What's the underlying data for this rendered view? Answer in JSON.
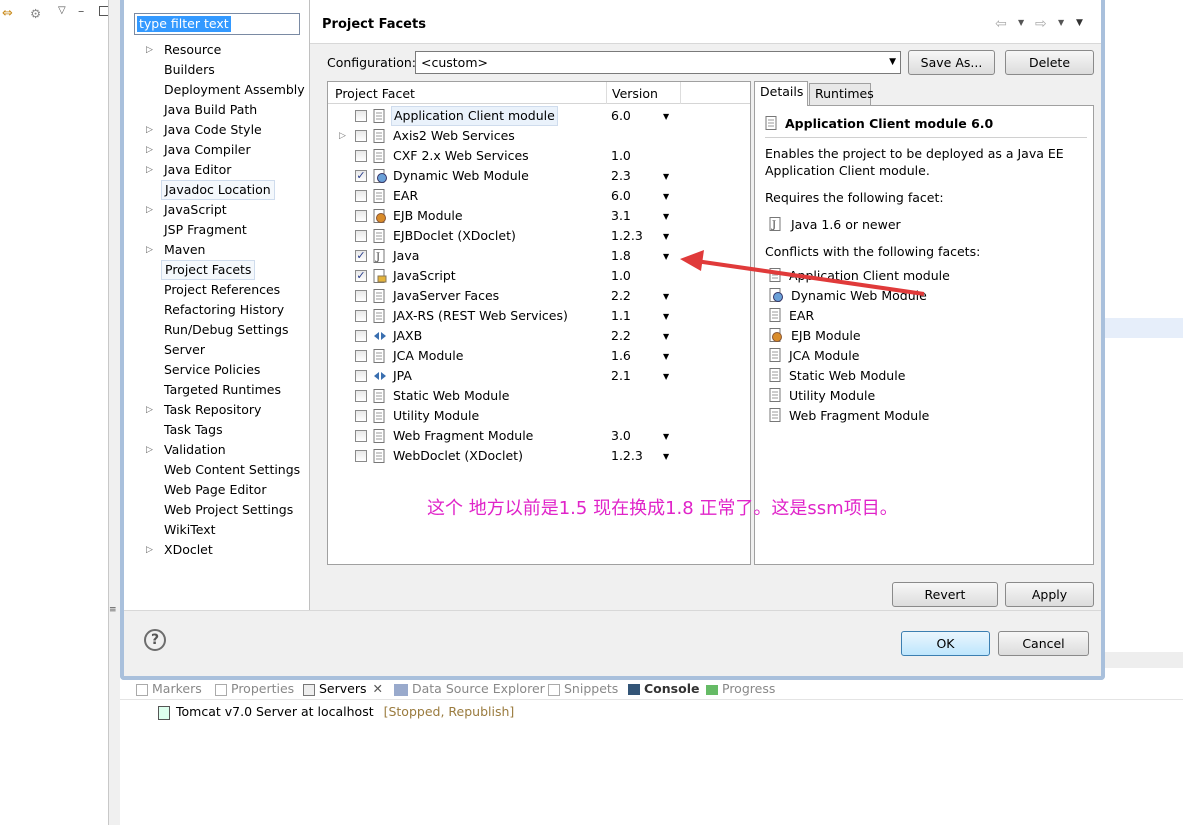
{
  "dialog": {
    "filter_placeholder": "type filter text",
    "nav_items": [
      {
        "label": "Resource",
        "expandable": true
      },
      {
        "label": "Builders",
        "expandable": false
      },
      {
        "label": "Deployment Assembly",
        "expandable": false
      },
      {
        "label": "Java Build Path",
        "expandable": false
      },
      {
        "label": "Java Code Style",
        "expandable": true
      },
      {
        "label": "Java Compiler",
        "expandable": true
      },
      {
        "label": "Java Editor",
        "expandable": true
      },
      {
        "label": "Javadoc Location",
        "expandable": false
      },
      {
        "label": "JavaScript",
        "expandable": true
      },
      {
        "label": "JSP Fragment",
        "expandable": false
      },
      {
        "label": "Maven",
        "expandable": true
      },
      {
        "label": "Project Facets",
        "expandable": false,
        "selected": true
      },
      {
        "label": "Project References",
        "expandable": false
      },
      {
        "label": "Refactoring History",
        "expandable": false
      },
      {
        "label": "Run/Debug Settings",
        "expandable": false
      },
      {
        "label": "Server",
        "expandable": false
      },
      {
        "label": "Service Policies",
        "expandable": false
      },
      {
        "label": "Targeted Runtimes",
        "expandable": false
      },
      {
        "label": "Task Repository",
        "expandable": true
      },
      {
        "label": "Task Tags",
        "expandable": false
      },
      {
        "label": "Validation",
        "expandable": true
      },
      {
        "label": "Web Content Settings",
        "expandable": false
      },
      {
        "label": "Web Page Editor",
        "expandable": false
      },
      {
        "label": "Web Project Settings",
        "expandable": false
      },
      {
        "label": "WikiText",
        "expandable": false
      },
      {
        "label": "XDoclet",
        "expandable": true
      }
    ],
    "page_title": "Project Facets",
    "configuration_label": "Configuration:",
    "configuration_value": "<custom>",
    "save_as_label": "Save As...",
    "delete_label": "Delete",
    "facet_col_header": "Project Facet",
    "version_col_header": "Version",
    "facets": [
      {
        "name": "Application Client module",
        "version": "6.0",
        "checked": false,
        "dropdown": true,
        "selected": true,
        "icon": "page-icon"
      },
      {
        "name": "Axis2 Web Services",
        "version": "",
        "checked": false,
        "dropdown": false,
        "expandable": true,
        "icon": "page-icon"
      },
      {
        "name": "CXF 2.x Web Services",
        "version": "1.0",
        "checked": false,
        "dropdown": false,
        "icon": "page-icon"
      },
      {
        "name": "Dynamic Web Module",
        "version": "2.3",
        "checked": true,
        "dropdown": true,
        "icon": "globe-icon"
      },
      {
        "name": "EAR",
        "version": "6.0",
        "checked": false,
        "dropdown": true,
        "icon": "page-icon"
      },
      {
        "name": "EJB Module",
        "version": "3.1",
        "checked": false,
        "dropdown": true,
        "icon": "bean-icon"
      },
      {
        "name": "EJBDoclet (XDoclet)",
        "version": "1.2.3",
        "checked": false,
        "dropdown": true,
        "icon": "page-icon"
      },
      {
        "name": "Java",
        "version": "1.8",
        "checked": true,
        "dropdown": true,
        "icon": "java-icon"
      },
      {
        "name": "JavaScript",
        "version": "1.0",
        "checked": true,
        "dropdown": false,
        "icon": "js-icon"
      },
      {
        "name": "JavaServer Faces",
        "version": "2.2",
        "checked": false,
        "dropdown": true,
        "icon": "page-icon"
      },
      {
        "name": "JAX-RS (REST Web Services)",
        "version": "1.1",
        "checked": false,
        "dropdown": true,
        "icon": "page-icon"
      },
      {
        "name": "JAXB",
        "version": "2.2",
        "checked": false,
        "dropdown": true,
        "icon": "arrows-icon"
      },
      {
        "name": "JCA Module",
        "version": "1.6",
        "checked": false,
        "dropdown": true,
        "icon": "page-icon"
      },
      {
        "name": "JPA",
        "version": "2.1",
        "checked": false,
        "dropdown": true,
        "icon": "arrows-icon"
      },
      {
        "name": "Static Web Module",
        "version": "",
        "checked": false,
        "dropdown": false,
        "icon": "page-icon"
      },
      {
        "name": "Utility Module",
        "version": "",
        "checked": false,
        "dropdown": false,
        "icon": "page-icon"
      },
      {
        "name": "Web Fragment Module",
        "version": "3.0",
        "checked": false,
        "dropdown": true,
        "icon": "page-icon"
      },
      {
        "name": "WebDoclet (XDoclet)",
        "version": "1.2.3",
        "checked": false,
        "dropdown": true,
        "icon": "page-icon"
      }
    ],
    "details_tab": "Details",
    "runtimes_tab": "Runtimes",
    "details": {
      "title": "Application Client module 6.0",
      "desc_line1": "Enables the project to be deployed as a Java EE",
      "desc_line2": "Application Client module.",
      "requires_label": "Requires the following facet:",
      "requires_item": "Java 1.6 or newer",
      "conflicts_label": "Conflicts with the following facets:",
      "conflicts": [
        "Application Client module",
        "Dynamic Web Module",
        "EAR",
        "EJB Module",
        "JCA Module",
        "Static Web Module",
        "Utility Module",
        "Web Fragment Module"
      ]
    },
    "annotation_note": "这个 地方以前是1.5  现在换成1.8 正常了。这是ssm项目。",
    "revert_label": "Revert",
    "apply_label": "Apply",
    "ok_label": "OK",
    "cancel_label": "Cancel",
    "help_glyph": "?"
  },
  "views": {
    "tabs": [
      "Markers",
      "Properties",
      "Servers",
      "Data Source Explorer",
      "Snippets",
      "Console",
      "Progress"
    ],
    "server_name": "Tomcat v7.0 Server at localhost",
    "server_state": "[Stopped, Republish]"
  },
  "colors": {
    "annotation": "#e024c9",
    "arrow": "#e03a3a",
    "dialog_border": "#a9c0dc"
  }
}
